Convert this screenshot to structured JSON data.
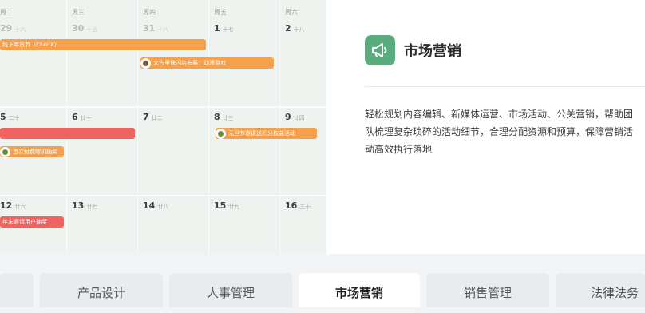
{
  "calendar": {
    "weekdays": [
      "周二",
      "周三",
      "周四",
      "周五",
      "周六"
    ],
    "week1": [
      {
        "day": "29",
        "lunar": "十六"
      },
      {
        "day": "30",
        "lunar": "十五"
      },
      {
        "day": "31",
        "lunar": "十八"
      },
      {
        "day": "1",
        "lunar": "十七"
      },
      {
        "day": "2",
        "lunar": "十八"
      }
    ],
    "week2": [
      {
        "day": "5",
        "lunar": "二十"
      },
      {
        "day": "6",
        "lunar": "廿一"
      },
      {
        "day": "7",
        "lunar": "廿二"
      },
      {
        "day": "8",
        "lunar": "廿三"
      },
      {
        "day": "9",
        "lunar": "廿四"
      }
    ],
    "week3": [
      {
        "day": "12",
        "lunar": "廿六"
      },
      {
        "day": "13",
        "lunar": "廿七"
      },
      {
        "day": "14",
        "lunar": "廿八"
      },
      {
        "day": "15",
        "lunar": "廿九"
      },
      {
        "day": "16",
        "lunar": "三十"
      }
    ],
    "events": {
      "club": "线下年货节（Club X）",
      "shop": "太古里快闪店布展：动漫游戏",
      "points": "元旦节邀请送积分权益活动",
      "lottery": "首次付费赠机抽奖",
      "invite": "年末邀请用户抽奖"
    },
    "colors": {
      "orange": "#f5a04c",
      "red": "#ef6461"
    }
  },
  "panel": {
    "icon": "megaphone-icon",
    "title": "市场营销",
    "description": "轻松规划内容编辑、新媒体运营、市场活动、公关营销，帮助团队梳理复杂琐碎的活动细节，合理分配资源和预算，保障营销活动高效执行落地",
    "accent": "#5aab7d"
  },
  "tabs": [
    "产品设计",
    "人事管理",
    "市场营销",
    "销售管理",
    "法律法务"
  ]
}
